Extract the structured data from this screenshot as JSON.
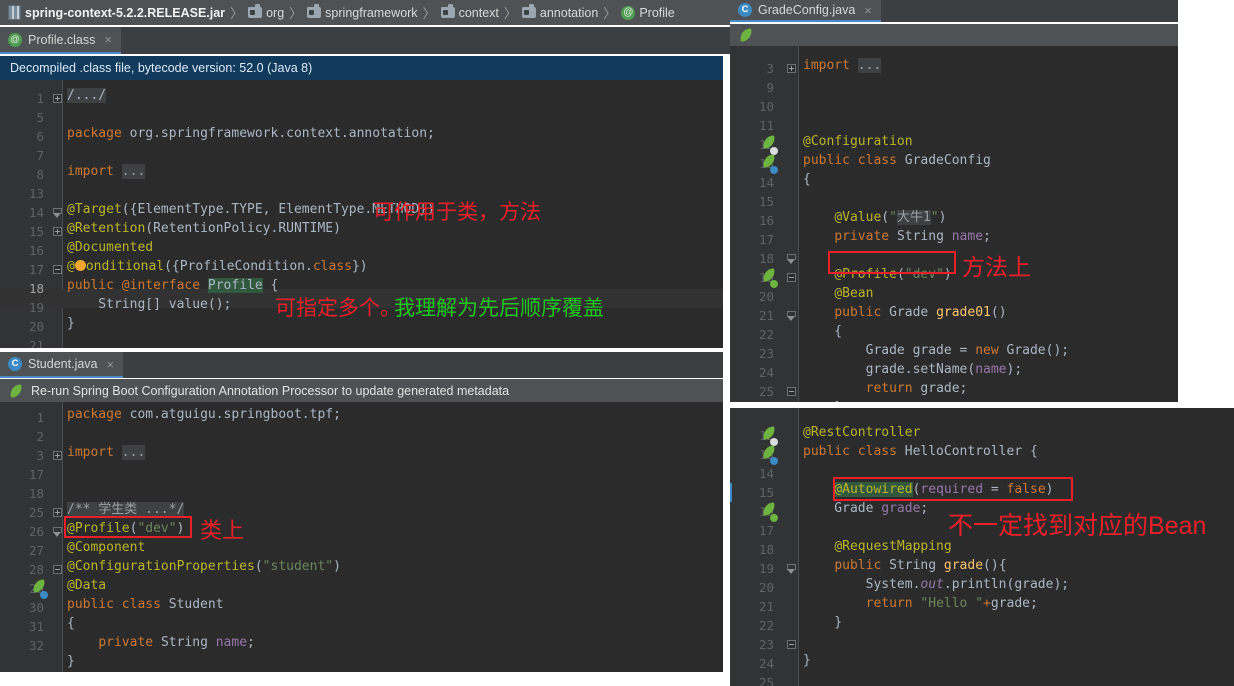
{
  "breadcrumb": {
    "items": [
      {
        "icon": "jar-icon",
        "label": "spring-context-5.2.2.RELEASE.jar"
      },
      {
        "icon": "folder-icon",
        "label": "org"
      },
      {
        "icon": "folder-icon",
        "label": "springframework"
      },
      {
        "icon": "folder-icon",
        "label": "context"
      },
      {
        "icon": "folder-icon",
        "label": "annotation"
      },
      {
        "icon": "annotation-icon",
        "label": "Profile"
      }
    ],
    "separator": "〉"
  },
  "panels": {
    "profile_class": {
      "tab_label": "Profile.class",
      "tab_icon": "annotation-icon",
      "tab_close": "×",
      "infobar": "Decompiled .class file, bytecode version: 52.0 (Java 8)",
      "lines": [
        {
          "n": "1",
          "fold": "plus",
          "text": "/.../",
          "kind": "foldcomment"
        },
        {
          "n": "5",
          "text": ""
        },
        {
          "n": "6",
          "segs": [
            [
              "kw",
              "package "
            ],
            [
              "plain",
              "org.springframework.context.annotation;"
            ]
          ]
        },
        {
          "n": "7",
          "text": ""
        },
        {
          "n": "8",
          "fold": "plus",
          "segs": [
            [
              "kw",
              "import "
            ],
            [
              "foldgrey",
              "..."
            ]
          ]
        },
        {
          "n": "13",
          "text": ""
        },
        {
          "n": "14",
          "fold": "top",
          "segs": [
            [
              "an",
              "@Target"
            ],
            [
              "plain",
              "({"
            ],
            [
              "plain",
              "ElementType.TYPE, ElementType.METHOD})"
            ]
          ]
        },
        {
          "n": "15",
          "segs": [
            [
              "an",
              "@Retention"
            ],
            [
              "plain",
              "(RetentionPolicy.RUNTIME)"
            ]
          ]
        },
        {
          "n": "16",
          "segs": [
            [
              "an",
              "@Documented"
            ]
          ]
        },
        {
          "n": "17",
          "fold": "minus",
          "segs": [
            [
              "an",
              "@"
            ],
            [
              "bulb",
              "●"
            ],
            [
              "an",
              "onditional"
            ],
            [
              "plain",
              "({ProfileCondition."
            ],
            [
              "kw",
              "class"
            ],
            [
              "plain",
              "})"
            ]
          ]
        },
        {
          "n": "18",
          "current": true,
          "segs": [
            [
              "kw",
              "public "
            ],
            [
              "kw",
              "@interface "
            ],
            [
              "hlgreen",
              "Profile"
            ],
            [
              "plain",
              " {"
            ]
          ]
        },
        {
          "n": "19",
          "segs": [
            [
              "plain",
              "    String[] value();"
            ]
          ]
        },
        {
          "n": "20",
          "segs": [
            [
              "plain",
              "}"
            ]
          ]
        },
        {
          "n": "21",
          "text": ""
        }
      ],
      "annotations": [
        {
          "text": "可作用于类，方法",
          "color": "red"
        },
        {
          "text": "可指定多个。",
          "color": "red"
        },
        {
          "text": "我理解为先后顺序覆盖",
          "color": "green"
        }
      ]
    },
    "student_java": {
      "tab_label": "Student.java",
      "tab_icon": "class-icon",
      "tab_close": "×",
      "infobar": "Re-run Spring Boot Configuration Annotation Processor to update generated metadata",
      "infobar_icon": "spring-rerun-icon",
      "lines": [
        {
          "n": "1",
          "segs": [
            [
              "kw",
              "package "
            ],
            [
              "plain",
              "com.atguigu.springboot.tpf;"
            ]
          ]
        },
        {
          "n": "2",
          "text": ""
        },
        {
          "n": "3",
          "fold": "plus",
          "segs": [
            [
              "kw",
              "import "
            ],
            [
              "foldgrey",
              "..."
            ]
          ]
        },
        {
          "n": "17",
          "text": ""
        },
        {
          "n": "18",
          "fold": "plus",
          "segs": [
            [
              "foldcmt",
              "/** 学生类 ...*/"
            ]
          ]
        },
        {
          "n": "25",
          "fold": "top",
          "segs": [
            [
              "an",
              "@Profile"
            ],
            [
              "plain",
              "("
            ],
            [
              "str",
              "\"dev\""
            ],
            [
              "plain",
              ")"
            ]
          ]
        },
        {
          "n": "26",
          "segs": [
            [
              "an",
              "@Component"
            ]
          ]
        },
        {
          "n": "27",
          "segs": [
            [
              "an",
              "@ConfigurationProperties"
            ],
            [
              "plain",
              "("
            ],
            [
              "str",
              "\"student\""
            ],
            [
              "plain",
              ")"
            ]
          ]
        },
        {
          "n": "28",
          "fold": "minus",
          "segs": [
            [
              "an",
              "@Data"
            ]
          ]
        },
        {
          "n": "29",
          "gicon": "spring-bean-icon",
          "segs": [
            [
              "kw",
              "public class "
            ],
            [
              "plain",
              "Student"
            ]
          ]
        },
        {
          "n": "30",
          "segs": [
            [
              "plain",
              "{"
            ]
          ]
        },
        {
          "n": "31",
          "segs": [
            [
              "plain",
              "    "
            ],
            [
              "kw",
              "private "
            ],
            [
              "ty",
              "String "
            ],
            [
              "fld",
              "name"
            ],
            [
              "plain",
              ";"
            ]
          ]
        },
        {
          "n": "32",
          "segs": [
            [
              "plain",
              "}"
            ]
          ]
        }
      ],
      "annotations": [
        {
          "text": "类上",
          "color": "red"
        }
      ],
      "highlight_box": "@Profile(\"dev\")"
    },
    "grade_config": {
      "tab_label": "GradeConfig.java",
      "tab_icon": "class-icon",
      "tab_close": "×",
      "infobar_icon": "spring-rerun-icon",
      "lines": [
        {
          "n": "3",
          "fold": "plus",
          "segs": [
            [
              "kw",
              "import "
            ],
            [
              "foldgrey",
              "..."
            ]
          ]
        },
        {
          "n": "9",
          "text": ""
        },
        {
          "n": "10",
          "text": ""
        },
        {
          "n": "11",
          "gicon": "spring-config-icon",
          "segs": [
            [
              "an",
              "@Configuration"
            ]
          ]
        },
        {
          "n": "12",
          "gicon": "spring-bean-icon",
          "segs": [
            [
              "kw",
              "public class "
            ],
            [
              "plain",
              "GradeConfig"
            ]
          ]
        },
        {
          "n": "13",
          "segs": [
            [
              "plain",
              "{"
            ]
          ]
        },
        {
          "n": "14",
          "text": ""
        },
        {
          "n": "15",
          "segs": [
            [
              "plain",
              "    "
            ],
            [
              "an",
              "@Value"
            ],
            [
              "plain",
              "("
            ],
            [
              "str",
              "\""
            ],
            [
              "hlgrey",
              "大牛1"
            ],
            [
              "str",
              "\""
            ],
            [
              "plain",
              ")"
            ]
          ]
        },
        {
          "n": "16",
          "segs": [
            [
              "plain",
              "    "
            ],
            [
              "kw",
              "private "
            ],
            [
              "ty",
              "String "
            ],
            [
              "fld",
              "name"
            ],
            [
              "plain",
              ";"
            ]
          ]
        },
        {
          "n": "17",
          "text": ""
        },
        {
          "n": "18",
          "fold": "minus",
          "segs": [
            [
              "plain",
              "    "
            ],
            [
              "an",
              "@Profile"
            ],
            [
              "plain",
              "("
            ],
            [
              "str",
              "\"dev\""
            ],
            [
              "plain",
              ")"
            ]
          ]
        },
        {
          "n": "19",
          "gicon": "spring-bean-arrow-icon",
          "fold": "minus",
          "segs": [
            [
              "plain",
              "    "
            ],
            [
              "an",
              "@Bean"
            ]
          ]
        },
        {
          "n": "20",
          "segs": [
            [
              "plain",
              "    "
            ],
            [
              "kw",
              "public "
            ],
            [
              "ty",
              "Grade "
            ],
            [
              "fn",
              "grade01"
            ],
            [
              "plain",
              "()"
            ]
          ]
        },
        {
          "n": "21",
          "fold": "minus",
          "segs": [
            [
              "plain",
              "    {"
            ]
          ]
        },
        {
          "n": "22",
          "segs": [
            [
              "plain",
              "        Grade grade = "
            ],
            [
              "kw",
              "new "
            ],
            [
              "plain",
              "Grade();"
            ]
          ]
        },
        {
          "n": "23",
          "segs": [
            [
              "plain",
              "        grade.setName("
            ],
            [
              "fld",
              "name"
            ],
            [
              "plain",
              ");"
            ]
          ]
        },
        {
          "n": "24",
          "segs": [
            [
              "plain",
              "        "
            ],
            [
              "kw",
              "return "
            ],
            [
              "plain",
              "grade;"
            ]
          ]
        },
        {
          "n": "25",
          "fold": "minus",
          "segs": [
            [
              "plain",
              "    }"
            ]
          ]
        }
      ],
      "annotations": [
        {
          "text": "方法上",
          "color": "red"
        }
      ],
      "highlight_box": "@Profile(\"dev\")"
    },
    "hello_controller": {
      "lines": [
        {
          "n": "12",
          "gicon": "spring-config-icon",
          "segs": [
            [
              "an",
              "@RestController"
            ]
          ]
        },
        {
          "n": "13",
          "gicon": "spring-bean-icon",
          "segs": [
            [
              "kw",
              "public class "
            ],
            [
              "plain",
              "HelloController {"
            ]
          ]
        },
        {
          "n": "14",
          "text": ""
        },
        {
          "n": "15",
          "segs": [
            [
              "plain",
              "    "
            ],
            [
              "hlgreen2",
              "@Autowired"
            ],
            [
              "plain",
              "("
            ],
            [
              "fld",
              "required"
            ],
            [
              "plain",
              " = "
            ],
            [
              "kw",
              "false"
            ],
            [
              "plain",
              ")"
            ]
          ]
        },
        {
          "n": "16",
          "gicon": "spring-bean-arrow-icon",
          "segs": [
            [
              "plain",
              "    Grade "
            ],
            [
              "fld",
              "grade"
            ],
            [
              "plain",
              ";"
            ]
          ]
        },
        {
          "n": "17",
          "text": ""
        },
        {
          "n": "18",
          "segs": [
            [
              "plain",
              "    "
            ],
            [
              "an",
              "@RequestMapping"
            ]
          ]
        },
        {
          "n": "19",
          "fold": "minus",
          "segs": [
            [
              "plain",
              "    "
            ],
            [
              "kw",
              "public "
            ],
            [
              "ty",
              "String "
            ],
            [
              "fn",
              "grade"
            ],
            [
              "plain",
              "(){"
            ]
          ]
        },
        {
          "n": "20",
          "segs": [
            [
              "plain",
              "        System."
            ],
            [
              "fldi",
              "out"
            ],
            [
              "plain",
              ".println(grade);"
            ]
          ]
        },
        {
          "n": "21",
          "segs": [
            [
              "plain",
              "        "
            ],
            [
              "kw",
              "return "
            ],
            [
              "str",
              "\"Hello \""
            ],
            [
              "kw",
              "+"
            ],
            [
              "plain",
              "grade;"
            ]
          ]
        },
        {
          "n": "22",
          "fold": "minus",
          "segs": [
            [
              "plain",
              "    }"
            ]
          ]
        },
        {
          "n": "23",
          "text": ""
        },
        {
          "n": "24",
          "segs": [
            [
              "plain",
              "}"
            ]
          ]
        },
        {
          "n": "25",
          "text": ""
        }
      ],
      "annotations": [
        {
          "text": "不一定找到对应的Bean",
          "color": "red"
        }
      ],
      "highlight_box": "@Autowired(required = false)"
    }
  },
  "colors": {
    "editor_bg": "#2b2b2b",
    "gutter_bg": "#313335",
    "tab_bg": "#4e5254",
    "tab_underline": "#4a88c7",
    "infobar_blue": "#113a5c",
    "annotation_red": "#e8202a",
    "annotation_green": "#1fc41f",
    "keyword": "#cc7832",
    "string": "#6a8759",
    "annotation_token": "#bbb529",
    "field": "#9876aa",
    "method": "#ffc66d",
    "default_text": "#a9b7c6"
  }
}
